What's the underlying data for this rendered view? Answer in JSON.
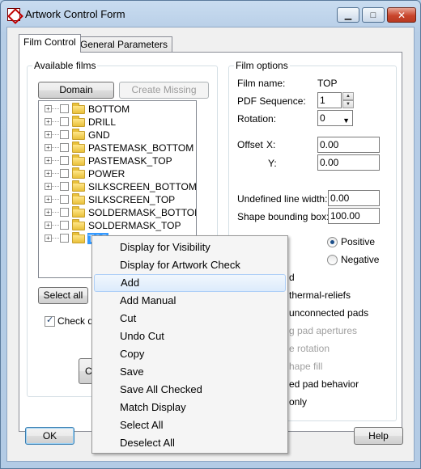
{
  "window": {
    "title": "Artwork Control Form",
    "minimize": "▁",
    "maximize": "□",
    "close": "✕"
  },
  "tabs": [
    {
      "label": "Film Control"
    },
    {
      "label": "General Parameters"
    }
  ],
  "available_films": {
    "group_label": "Available films",
    "domain_selection": "Domain Selection",
    "create_missing": "Create Missing Films",
    "films": [
      "BOTTOM",
      "DRILL",
      "GND",
      "PASTEMASK_BOTTOM",
      "PASTEMASK_TOP",
      "POWER",
      "SILKSCREEN_BOTTOM",
      "SILKSCREEN_TOP",
      "SOLDERMASK_BOTTOM",
      "SOLDERMASK_TOP",
      "TOP"
    ],
    "selected_film": "TOP",
    "select_all": "Select all",
    "check_prefix": "Check da",
    "partial_button": "Cr"
  },
  "film_options": {
    "group_label": "Film options",
    "film_name_label": "Film name:",
    "film_name_value": "TOP",
    "pdf_sequence_label": "PDF Sequence:",
    "pdf_sequence_value": "1",
    "rotation_label": "Rotation:",
    "rotation_value": "0",
    "offset_label": "Offset",
    "offset_x_label": "X:",
    "offset_x_value": "0.00",
    "offset_y_label": "Y:",
    "offset_y_value": "0.00",
    "undefined_line_width_label": "Undefined line width:",
    "undefined_line_width_value": "0.00",
    "shape_bounding_box_label": "Shape bounding box:",
    "shape_bounding_box_value": "100.00",
    "positive_label": "Positive",
    "negative_label": "Negative",
    "partial_options": [
      "d",
      "thermal-reliefs",
      "unconnected pads",
      "g pad apertures",
      "e rotation",
      "hape fill",
      "ed pad behavior",
      "only"
    ]
  },
  "footer": {
    "ok": "OK",
    "help": "Help"
  },
  "context_menu": {
    "items": [
      "Display for Visibility",
      "Display for Artwork Check",
      "Add",
      "Add Manual",
      "Cut",
      "Undo Cut",
      "Copy",
      "Save",
      "Save All Checked",
      "Match Display",
      "Select All",
      "Deselect All"
    ],
    "highlighted": "Add"
  },
  "colors": {
    "selection": "#3399ff",
    "title_bar": "#b9d1ea",
    "close_button": "#c9452c"
  }
}
